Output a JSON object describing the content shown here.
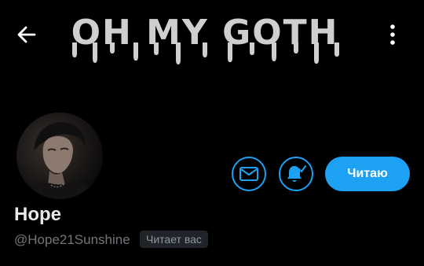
{
  "banner": {
    "title": "OH MY GOTH"
  },
  "nav": {
    "back_icon": "arrow-left-icon",
    "menu_icon": "more-vertical-icon"
  },
  "profile": {
    "display_name": "Hope",
    "handle": "@Hope21Sunshine",
    "follows_you_badge": "Читает вас",
    "avatar_icon": "profile-photo"
  },
  "actions": {
    "message_icon": "envelope-icon",
    "notify_icon": "bell-check-icon",
    "follow_label": "Читаю"
  },
  "colors": {
    "background": "#000000",
    "accent": "#1da1f2",
    "drip_text": "#cfcfcf",
    "secondary_text": "#71767b"
  }
}
